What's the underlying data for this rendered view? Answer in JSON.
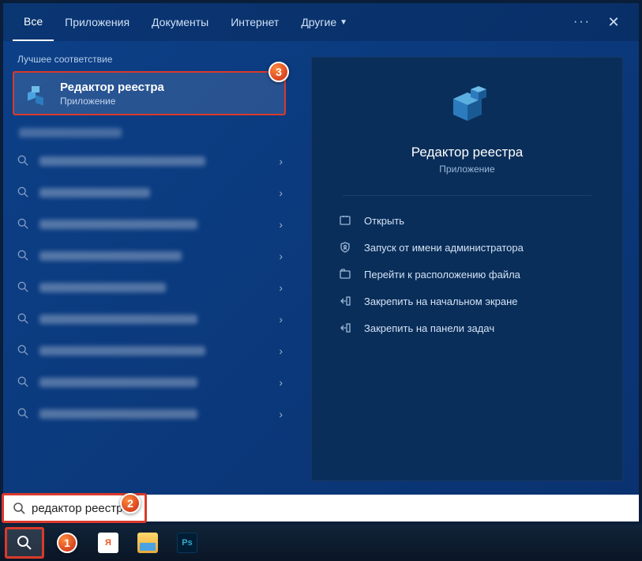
{
  "tabs": {
    "all": "Все",
    "apps": "Приложения",
    "docs": "Документы",
    "internet": "Интернет",
    "more": "Другие"
  },
  "left": {
    "section": "Лучшее соответствие",
    "best": {
      "name": "Редактор реестра",
      "type": "Приложение"
    },
    "blur_widths": [
      210,
      140,
      200,
      180,
      160,
      200,
      210,
      200,
      200
    ]
  },
  "right": {
    "title": "Редактор реестра",
    "subtitle": "Приложение",
    "actions": [
      {
        "icon": "open",
        "label": "Открыть"
      },
      {
        "icon": "admin",
        "label": "Запуск от имени администратора"
      },
      {
        "icon": "location",
        "label": "Перейти к расположению файла"
      },
      {
        "icon": "pin-start",
        "label": "Закрепить на начальном экране"
      },
      {
        "icon": "pin-task",
        "label": "Закрепить на панели задач"
      }
    ]
  },
  "search": {
    "value": "редактор реестра"
  },
  "callouts": {
    "c1": "1",
    "c2": "2",
    "c3": "3"
  },
  "taskbar": {
    "items": [
      {
        "id": "search",
        "kind": "search"
      },
      {
        "id": "yandex",
        "kind": "yandex",
        "letter": "Я"
      },
      {
        "id": "explorer",
        "kind": "explorer"
      },
      {
        "id": "ps",
        "kind": "ps",
        "letter": "Ps"
      }
    ]
  }
}
